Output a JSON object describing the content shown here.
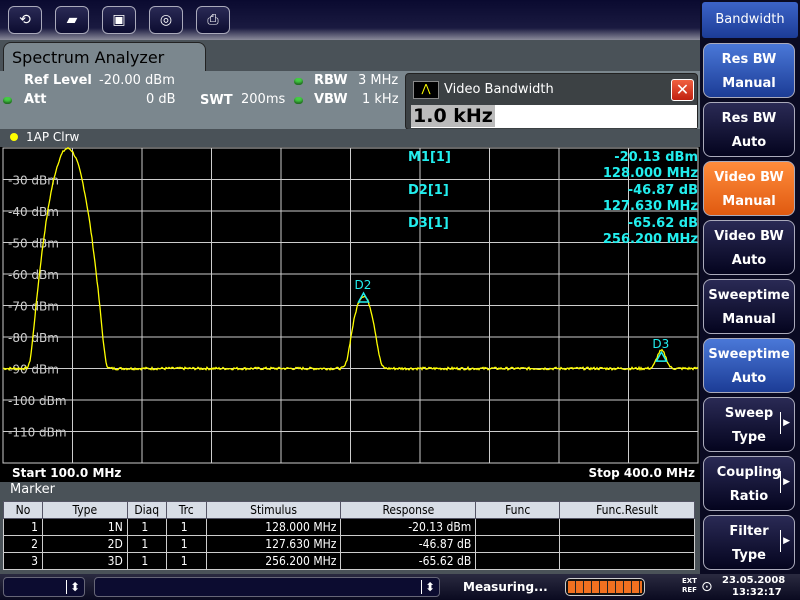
{
  "toolbar": {
    "icons": [
      "macro-icon",
      "open-folder-icon",
      "save-disk-icon",
      "camera-icon",
      "printer-icon"
    ]
  },
  "tab": {
    "title": "Spectrum Analyzer"
  },
  "params": {
    "ref_level_label": "Ref Level",
    "ref_level_value": "-20.00 dBm",
    "att_label": "Att",
    "att_value": "0 dB",
    "swt_label": "SWT",
    "swt_value": "200ms",
    "rbw_label": "RBW",
    "rbw_value": "3 MHz",
    "vbw_label": "VBW",
    "vbw_value": "1 kHz"
  },
  "dialog": {
    "title": "Video Bandwidth",
    "value": "1.0 kHz"
  },
  "trace": {
    "label": "1AP Clrw",
    "color": "#ffff00"
  },
  "markers_info": [
    {
      "name": "M1[1]",
      "value": "-20.13 dBm",
      "freq": "128.000 MHz"
    },
    {
      "name": "D2[1]",
      "value": "-46.87 dB",
      "freq": "127.630 MHz"
    },
    {
      "name": "D3[1]",
      "value": "-65.62 dB",
      "freq": "256.200 MHz"
    }
  ],
  "chart_data": {
    "type": "line",
    "xlim": [
      100,
      400
    ],
    "x_unit": "MHz",
    "ylim": [
      -120,
      -20
    ],
    "y_ticks": [
      "-30 dBm",
      "-40 dBm",
      "-50 dBm",
      "-60 dBm",
      "-70 dBm",
      "-80 dBm",
      "-90 dBm",
      "-100 dBm",
      "-110 dBm"
    ],
    "grid": true,
    "noise_floor_dbm": -90,
    "peaks": [
      {
        "freq": 128.0,
        "level": -20.13
      },
      {
        "freq": 255.63,
        "level": -67.0
      },
      {
        "freq": 384.2,
        "level": -85.75
      }
    ],
    "marker_labels": [
      {
        "label": "D2",
        "freq": 255.63,
        "level": -67.0
      },
      {
        "label": "D3",
        "freq": 384.2,
        "level": -85.75
      }
    ]
  },
  "freq": {
    "start": "Start 100.0 MHz",
    "stop": "Stop 400.0 MHz"
  },
  "marker_table": {
    "title": "Marker",
    "headers": [
      "No",
      "Type",
      "Diaq",
      "Trc",
      "Stimulus",
      "Response",
      "Func",
      "Func.Result"
    ],
    "rows": [
      [
        "1",
        "1N",
        "1",
        "1",
        "128.000 MHz",
        "-20.13 dBm",
        "",
        ""
      ],
      [
        "2",
        "2D",
        "1",
        "1",
        "127.630 MHz",
        "-46.87 dB",
        "",
        ""
      ],
      [
        "3",
        "3D",
        "1",
        "1",
        "256.200 MHz",
        "-65.62 dB",
        "",
        ""
      ]
    ]
  },
  "softkeys": {
    "header": "Bandwidth",
    "items": [
      {
        "l1": "Res BW",
        "l2": "Manual",
        "state": "blue"
      },
      {
        "l1": "Res BW",
        "l2": "Auto",
        "state": "dark"
      },
      {
        "l1": "Video BW",
        "l2": "Manual",
        "state": "orange"
      },
      {
        "l1": "Video BW",
        "l2": "Auto",
        "state": "dark"
      },
      {
        "l1": "Sweeptime",
        "l2": "Manual",
        "state": "dark"
      },
      {
        "l1": "Sweeptime",
        "l2": "Auto",
        "state": "blue"
      },
      {
        "l1": "Sweep",
        "l2": "Type",
        "state": "dark",
        "submenu": true
      },
      {
        "l1": "Coupling",
        "l2": "Ratio",
        "state": "dark",
        "submenu": true
      },
      {
        "l1": "Filter",
        "l2": "Type",
        "state": "dark",
        "submenu": true
      }
    ]
  },
  "status": {
    "text": "Measuring...",
    "progress": 1.0,
    "ext_ref": "EXT REF",
    "date": "23.05.2008",
    "time": "13:32:17"
  }
}
